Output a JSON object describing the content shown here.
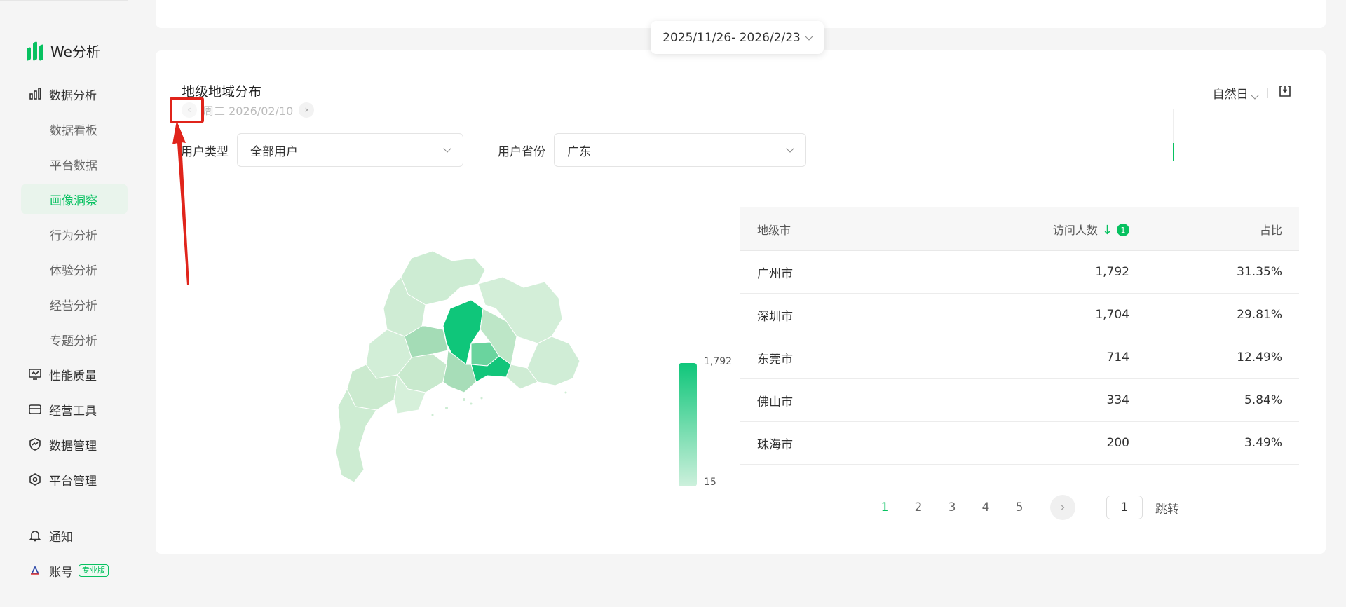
{
  "app": {
    "name": "We分析"
  },
  "sidebar": {
    "items": [
      {
        "label": "数据分析",
        "type": "group",
        "icon": "bar-chart-icon"
      },
      {
        "label": "数据看板",
        "type": "sub"
      },
      {
        "label": "平台数据",
        "type": "sub"
      },
      {
        "label": "画像洞察",
        "type": "sub",
        "active": true
      },
      {
        "label": "行为分析",
        "type": "sub"
      },
      {
        "label": "体验分析",
        "type": "sub"
      },
      {
        "label": "经营分析",
        "type": "sub"
      },
      {
        "label": "专题分析",
        "type": "sub"
      },
      {
        "label": "性能质量",
        "type": "group",
        "icon": "monitor-icon"
      },
      {
        "label": "经营工具",
        "type": "group",
        "icon": "store-icon"
      },
      {
        "label": "数据管理",
        "type": "group",
        "icon": "data-shield-icon"
      },
      {
        "label": "平台管理",
        "type": "group",
        "icon": "hexagon-settings-icon"
      }
    ],
    "notify": {
      "label": "通知",
      "icon": "bell-icon"
    },
    "account": {
      "label": "账号",
      "badge": "专业版",
      "icon": "avatar-icon"
    }
  },
  "date_range": {
    "value": "2025/11/26- 2026/2/23"
  },
  "section": {
    "title": "地级地域分布",
    "date_label": "周二 2026/02/10",
    "granularity": "自然日"
  },
  "filters": {
    "user_type": {
      "label": "用户类型",
      "value": "全部用户"
    },
    "province": {
      "label": "用户省份",
      "value": "广东"
    }
  },
  "legend": {
    "max": "1,792",
    "min": "15"
  },
  "table": {
    "headers": {
      "city": "地级市",
      "visitors": "访问人数",
      "sort_badge": "1",
      "share": "占比"
    },
    "rows": [
      {
        "city": "广州市",
        "visitors": "1,792",
        "share": "31.35%"
      },
      {
        "city": "深圳市",
        "visitors": "1,704",
        "share": "29.81%"
      },
      {
        "city": "东莞市",
        "visitors": "714",
        "share": "12.49%"
      },
      {
        "city": "佛山市",
        "visitors": "334",
        "share": "5.84%"
      },
      {
        "city": "珠海市",
        "visitors": "200",
        "share": "3.49%"
      }
    ]
  },
  "pagination": {
    "pages": [
      "1",
      "2",
      "3",
      "4",
      "5"
    ],
    "current": "1",
    "jump_value": "1",
    "jump_label": "跳转"
  },
  "colors": {
    "accent": "#07c160",
    "highlight": "#e0241b",
    "map_low": "#cdecd3",
    "map_high": "#0fc67a"
  }
}
